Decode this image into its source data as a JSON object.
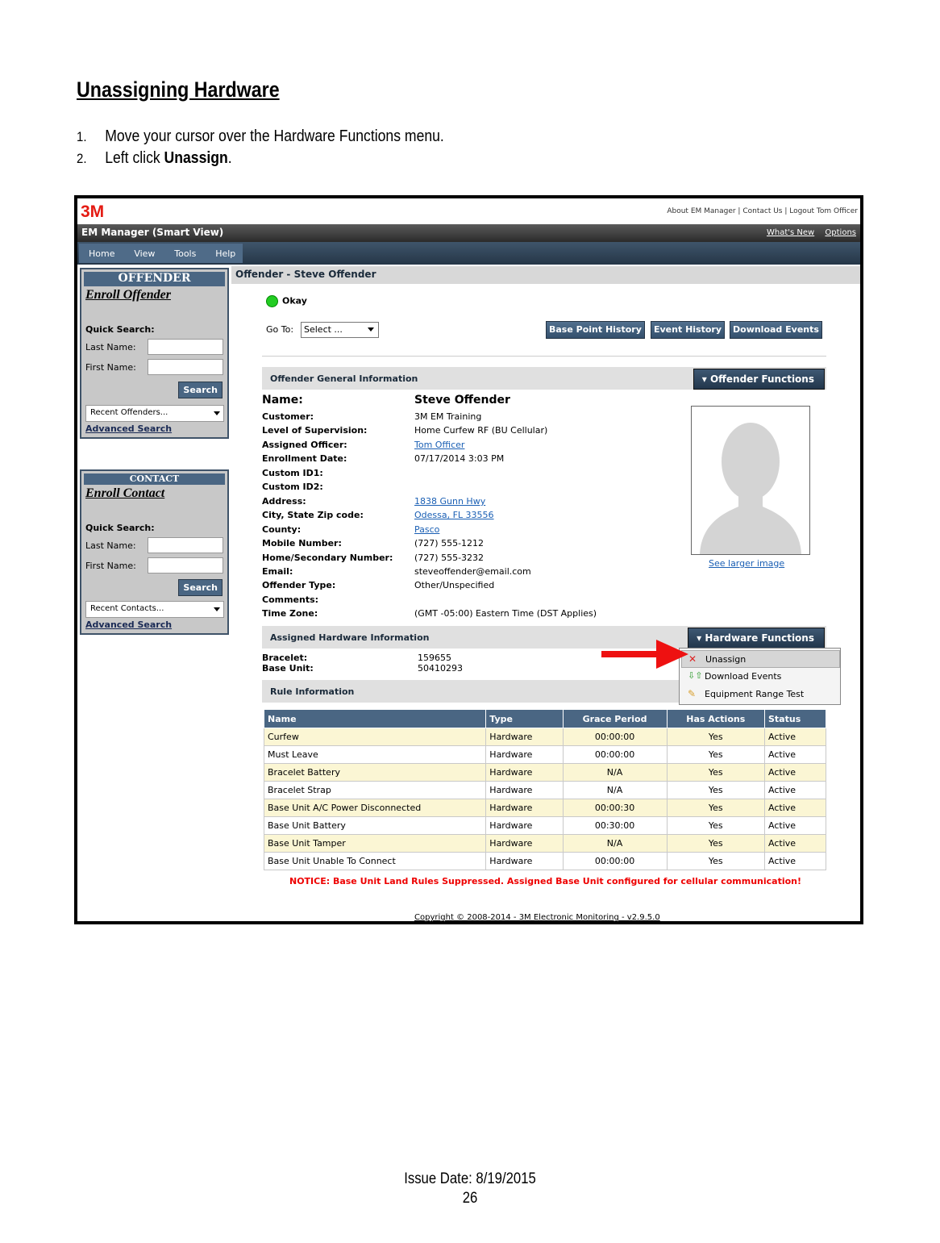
{
  "doc": {
    "title": "Unassigning Hardware",
    "steps": [
      {
        "num": "1.",
        "text": "Move your cursor over the Hardware Functions menu."
      },
      {
        "num": "2.",
        "text_prefix": "Left click ",
        "text_bold": "Unassign",
        "text_suffix": "."
      }
    ],
    "footer": {
      "issue": "Issue Date: 8/19/2015",
      "page": "26"
    }
  },
  "app": {
    "logo": "3M",
    "top_links": "About EM Manager | Contact Us | Logout Tom Officer",
    "title": "EM Manager (Smart View)",
    "title_links": [
      "What's New",
      "Options"
    ],
    "menu": [
      "Home",
      "View",
      "Tools",
      "Help"
    ],
    "offender_panel": {
      "header": "OFFENDER",
      "enroll": "Enroll Offender",
      "quick_search": "Quick Search:",
      "last_name": "Last Name:",
      "first_name": "First Name:",
      "search": "Search",
      "recent": "Recent Offenders...",
      "advanced": "Advanced Search"
    },
    "contact_panel": {
      "header": "CONTACT",
      "enroll": "Enroll Contact",
      "quick_search": "Quick Search:",
      "last_name": "Last Name:",
      "first_name": "First Name:",
      "search": "Search",
      "recent": "Recent Contacts...",
      "advanced": "Advanced Search"
    },
    "offender_header": "Offender - Steve Offender",
    "status": "Okay",
    "goto_label": "Go To:",
    "goto_value": "Select ...",
    "buttons": [
      "Base Point History",
      "Event History",
      "Download Events"
    ],
    "general_section": "Offender General Information",
    "offender_functions": "Offender Functions",
    "fields": [
      {
        "k": "Name:",
        "v": "Steve Offender"
      },
      {
        "k": "Customer:",
        "v": "3M EM Training"
      },
      {
        "k": "Level of Supervision:",
        "v": "Home Curfew RF (BU Cellular)"
      },
      {
        "k": "Assigned Officer:",
        "v": "Tom Officer"
      },
      {
        "k": "Enrollment Date:",
        "v": "07/17/2014 3:03 PM"
      },
      {
        "k": "Custom ID1:",
        "v": ""
      },
      {
        "k": "Custom ID2:",
        "v": ""
      },
      {
        "k": "Address:",
        "v": "1838 Gunn Hwy"
      },
      {
        "k": "City, State Zip code:",
        "v": "Odessa, FL 33556"
      },
      {
        "k": "County:",
        "v": "Pasco"
      },
      {
        "k": "Mobile Number:",
        "v": "(727) 555-1212"
      },
      {
        "k": "Home/Secondary Number:",
        "v": "(727) 555-3232"
      },
      {
        "k": "Email:",
        "v": "steveoffender@email.com"
      },
      {
        "k": "Offender Type:",
        "v": "Other/Unspecified"
      },
      {
        "k": "Comments:",
        "v": ""
      },
      {
        "k": "Time Zone:",
        "v": "(GMT -05:00) Eastern Time (DST Applies)"
      }
    ],
    "see_larger": "See larger image",
    "hardware_section": "Assigned Hardware Information",
    "hardware_functions": "Hardware Functions",
    "hardware_menu": [
      "Unassign",
      "Download Events",
      "Equipment Range Test"
    ],
    "bracelet_label": "Bracelet:",
    "bracelet_value": "159655",
    "base_label": "Base Unit:",
    "base_value": "50410293",
    "rule_section": "Rule Information",
    "rule_columns": [
      "Name",
      "Type",
      "Grace Period",
      "Has Actions",
      "Status"
    ],
    "rules": [
      [
        "Curfew",
        "Hardware",
        "00:00:00",
        "Yes",
        "Active"
      ],
      [
        "Must Leave",
        "Hardware",
        "00:00:00",
        "Yes",
        "Active"
      ],
      [
        "Bracelet Battery",
        "Hardware",
        "N/A",
        "Yes",
        "Active"
      ],
      [
        "Bracelet Strap",
        "Hardware",
        "N/A",
        "Yes",
        "Active"
      ],
      [
        "Base Unit A/C Power Disconnected",
        "Hardware",
        "00:00:30",
        "Yes",
        "Active"
      ],
      [
        "Base Unit Battery",
        "Hardware",
        "00:30:00",
        "Yes",
        "Active"
      ],
      [
        "Base Unit Tamper",
        "Hardware",
        "N/A",
        "Yes",
        "Active"
      ],
      [
        "Base Unit Unable To Connect",
        "Hardware",
        "00:00:00",
        "Yes",
        "Active"
      ]
    ],
    "notice": "NOTICE: Base Unit Land Rules Suppressed. Assigned Base Unit configured for cellular communication!",
    "copyright": "Copyright © 2008-2014 - 3M Electronic Monitoring - v2.9.5.0",
    "colors": {
      "accent": "#4a6683",
      "arrow": "#ee1111",
      "status_ok": "#22cc22"
    }
  }
}
